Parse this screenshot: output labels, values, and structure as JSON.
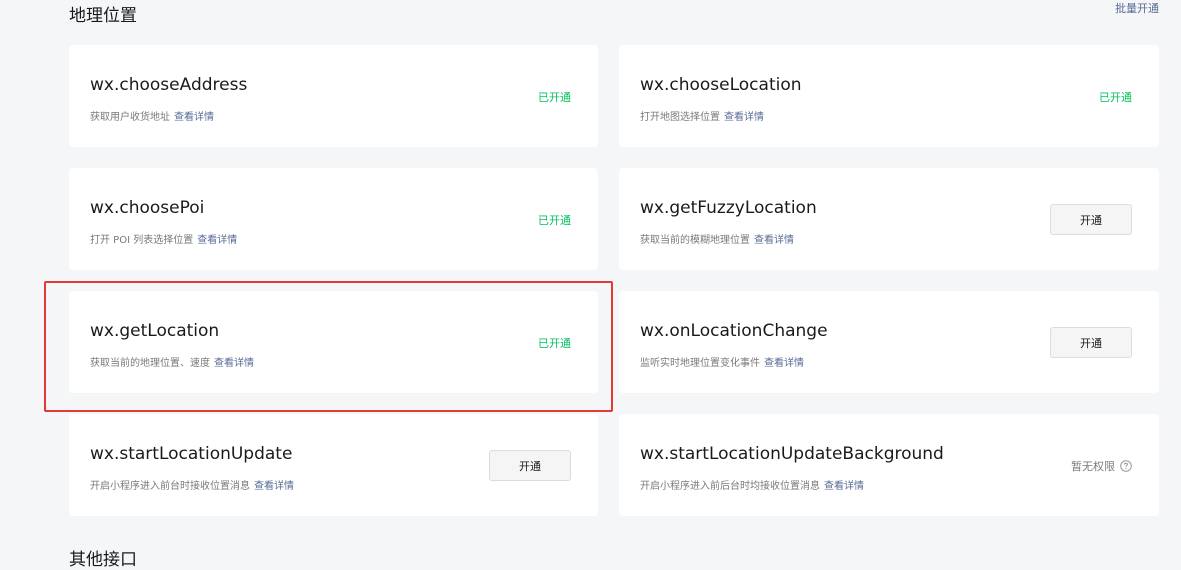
{
  "section": {
    "title": "地理位置",
    "bulk_open_label": "批量开通"
  },
  "cards": [
    {
      "name": "wx.chooseAddress",
      "desc": "获取用户收货地址",
      "detail": "查看详情",
      "status_type": "opened",
      "status_label": "已开通"
    },
    {
      "name": "wx.chooseLocation",
      "desc": "打开地图选择位置",
      "detail": "查看详情",
      "status_type": "opened",
      "status_label": "已开通"
    },
    {
      "name": "wx.choosePoi",
      "desc": "打开 POI 列表选择位置",
      "detail": "查看详情",
      "status_type": "opened",
      "status_label": "已开通"
    },
    {
      "name": "wx.getFuzzyLocation",
      "desc": "获取当前的模糊地理位置",
      "detail": "查看详情",
      "status_type": "button",
      "status_label": "开通"
    },
    {
      "name": "wx.getLocation",
      "desc": "获取当前的地理位置、速度",
      "detail": "查看详情",
      "status_type": "opened",
      "status_label": "已开通"
    },
    {
      "name": "wx.onLocationChange",
      "desc": "监听实时地理位置变化事件",
      "detail": "查看详情",
      "status_type": "button",
      "status_label": "开通"
    },
    {
      "name": "wx.startLocationUpdate",
      "desc": "开启小程序进入前台时接收位置消息",
      "detail": "查看详情",
      "status_type": "button",
      "status_label": "开通"
    },
    {
      "name": "wx.startLocationUpdateBackground",
      "desc": "开启小程序进入前后台时均接收位置消息",
      "detail": "查看详情",
      "status_type": "no_permission",
      "status_label": "暂无权限",
      "icon": "help-circle-icon"
    }
  ],
  "highlighted_card": "wx.getLocation",
  "colors": {
    "opened": "#07c160",
    "link": "#576b95",
    "highlight": "#e53935"
  },
  "next_section": {
    "title": "其他接口"
  }
}
